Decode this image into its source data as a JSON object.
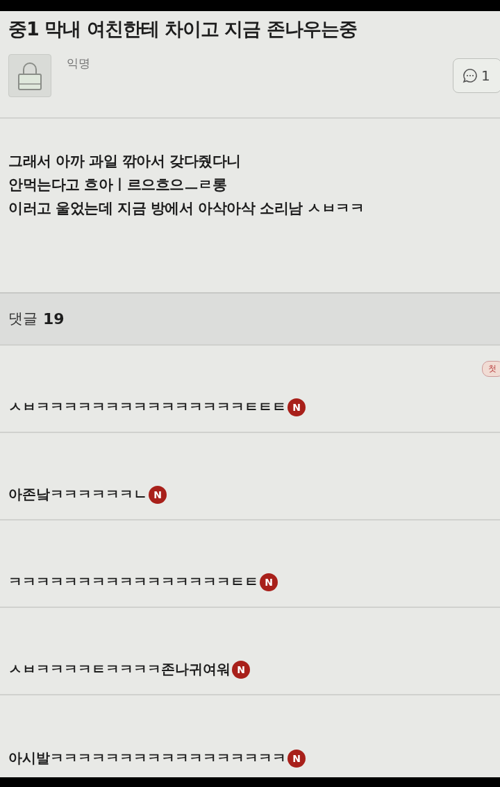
{
  "post": {
    "title": "중1 막내 여친한테 차이고 지금 존나우는중",
    "author": "익명",
    "comment_button": {
      "count": "1"
    },
    "body": [
      "그래서 아까 과일 깎아서 갖다줬다니",
      "안먹는다고 흐아ㅣ르으흐으ㅡㄹ롱",
      "이러고 울었는데 지금 방에서 아삭아삭 소리남 ㅅㅂㅋㅋ"
    ]
  },
  "comments_header": {
    "label": "댓글",
    "count": "19"
  },
  "comments": [
    {
      "text": "ㅅㅂㅋㅋㅋㅋㅋㅋㅋㅋㅋㅋㅋㅋㅋㅋㅋㅌㅌㅌ",
      "new_badge": "N",
      "tag": "첫"
    },
    {
      "text": "아존낰ㅋㅋㅋㅋㅋㅋㄴ",
      "new_badge": "N"
    },
    {
      "text": "ㅋㅋㅋㅋㅋㅋㅋㅋㅋㅋㅋㅋㅋㅋㅋㅋㅌㅌ",
      "new_badge": "N"
    },
    {
      "text": "ㅅㅂㅋㅋㅋㅋㅌㅋㅋㅋㅋ존나귀여워",
      "new_badge": "N"
    },
    {
      "text": "아시발ㅋㅋㅋㅋㅋㅋㅋㅋㅋㅋㅋㅋㅋㅋㅋㅋㅋ",
      "new_badge": "N"
    }
  ]
}
